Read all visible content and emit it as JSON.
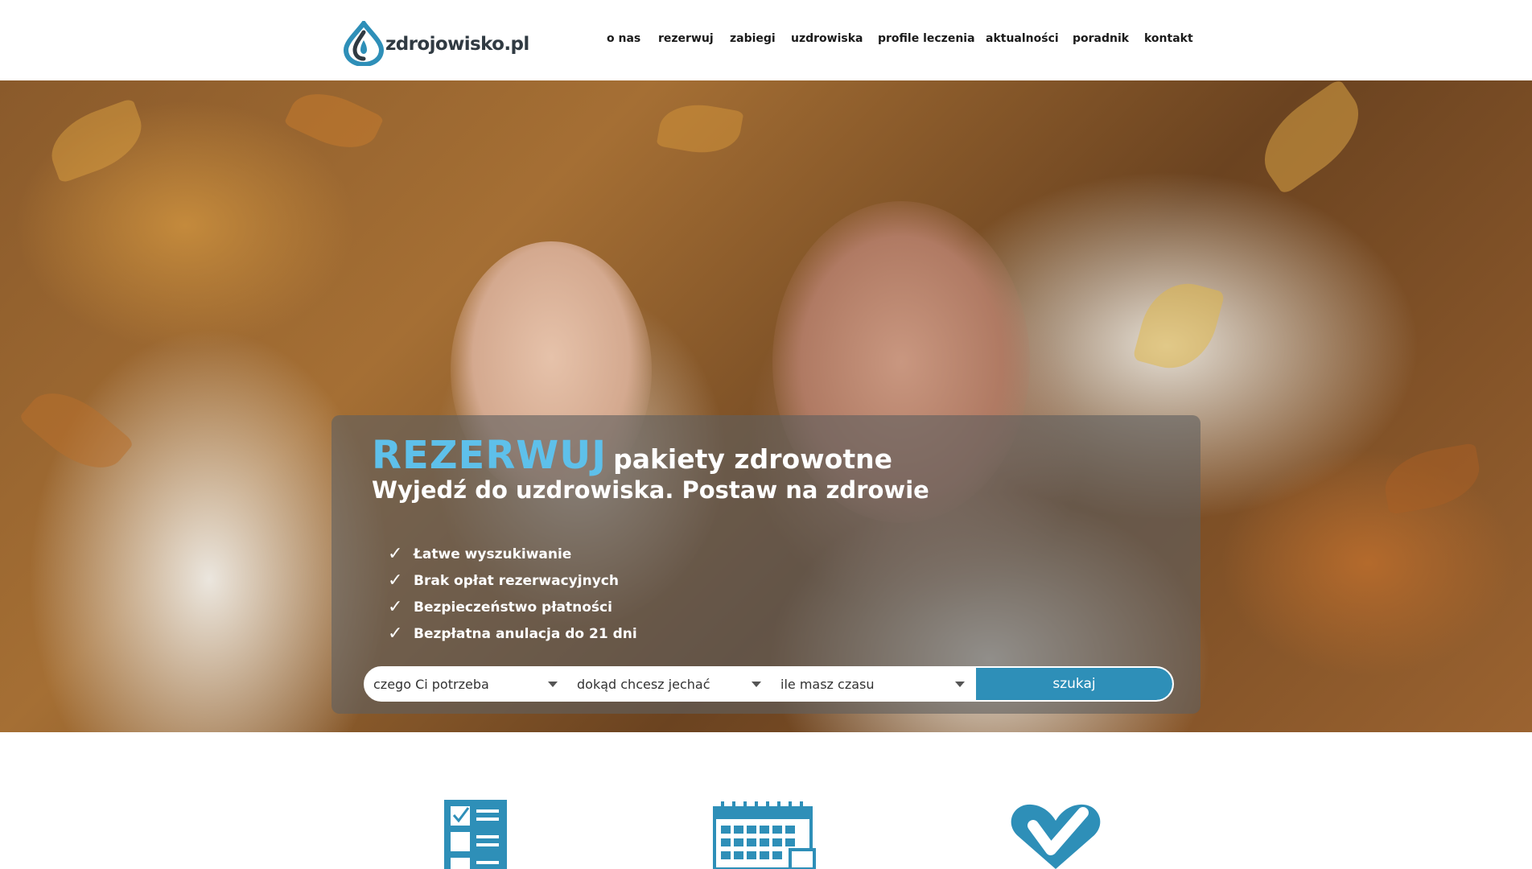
{
  "brand": {
    "logo_text": "zdrojowisko.pl",
    "accent_color": "#2e8fb8",
    "headline_accent_color": "#5ec0ea",
    "logo_dark_color": "#303a42"
  },
  "nav": {
    "items": [
      {
        "label": "o nas"
      },
      {
        "label": "rezerwuj"
      },
      {
        "label": "zabiegi"
      },
      {
        "label": "uzdrowiska"
      },
      {
        "label": "profile leczenia"
      },
      {
        "label": "aktualności"
      },
      {
        "label": "poradnik"
      },
      {
        "label": "kontakt"
      }
    ]
  },
  "hero": {
    "image": "photo of smiling senior couple in knit sweaters lying on autumn leaves",
    "headline_accent": "REZERWUJ",
    "headline_rest": "pakiety zdrowotne",
    "subheadline": "Wyjedź do uzdrowiska. Postaw na zdrowie",
    "features": [
      {
        "icon": "checkmark-icon",
        "label": "Łatwe wyszukiwanie"
      },
      {
        "icon": "checkmark-icon",
        "label": "Brak opłat rezerwacyjnych"
      },
      {
        "icon": "checkmark-icon",
        "label": "Bezpieczeństwo płatności"
      },
      {
        "icon": "checkmark-icon",
        "label": "Bezpłatna anulacja do 21 dni"
      }
    ]
  },
  "search": {
    "need_select": "czego Ci potrzeba",
    "destination_select": "dokąd chcesz jechać",
    "duration_select": "ile masz czasu",
    "submit_label": "szukaj"
  },
  "benefits": {
    "icons": [
      "checklist-icon",
      "calendar-icon",
      "heart-check-icon"
    ]
  }
}
